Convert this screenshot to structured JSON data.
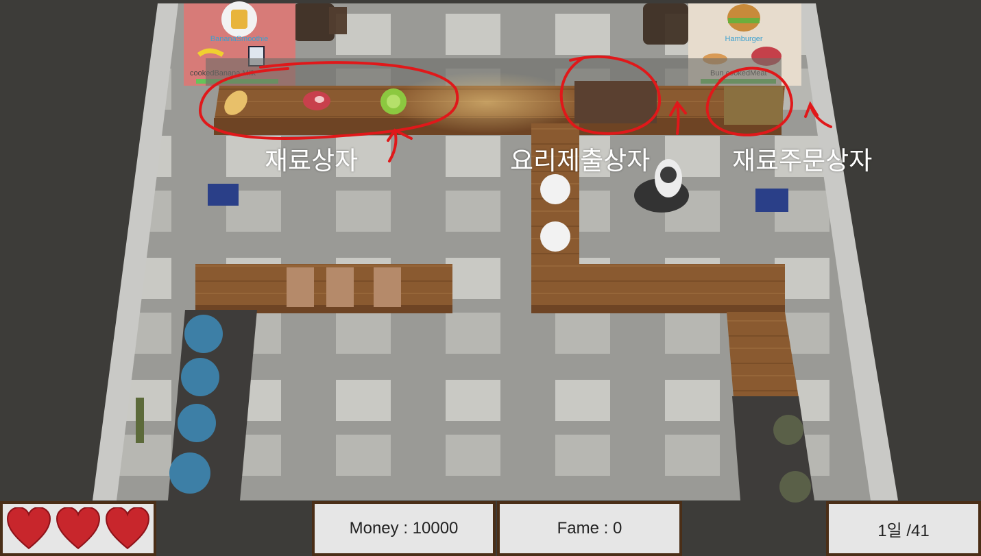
{
  "hud": {
    "money": "Money : 10000",
    "fame": "Fame : 0",
    "day": "1일 /41",
    "lives": 3
  },
  "annotations": {
    "ingredient_box": "재료상자",
    "dish_submit_box": "요리제출상자",
    "ingredient_order_box": "재료주문상자"
  },
  "orders": [
    {
      "dish": "BananaSmoothie",
      "ingredients": [
        "cookedBanana",
        "Milk"
      ],
      "ingredient_icons": [
        "banana-icon",
        "milk-icon"
      ],
      "dish_icon": "smoothie-icon"
    },
    {
      "dish": "Hamburger",
      "ingredients": [
        "Bun",
        "cookedMeat"
      ],
      "ingredient_icons": [
        "bun-icon",
        "meat-icon"
      ],
      "dish_icon": "hamburger-icon"
    }
  ],
  "ingredient_items": [
    "bread-icon",
    "meat-icon",
    "cabbage-icon"
  ],
  "colors": {
    "annotation_red": "#e0181a",
    "counter_wood": "#8a5a30",
    "hud_border": "#4a2e17",
    "heart": "#c8262c"
  }
}
